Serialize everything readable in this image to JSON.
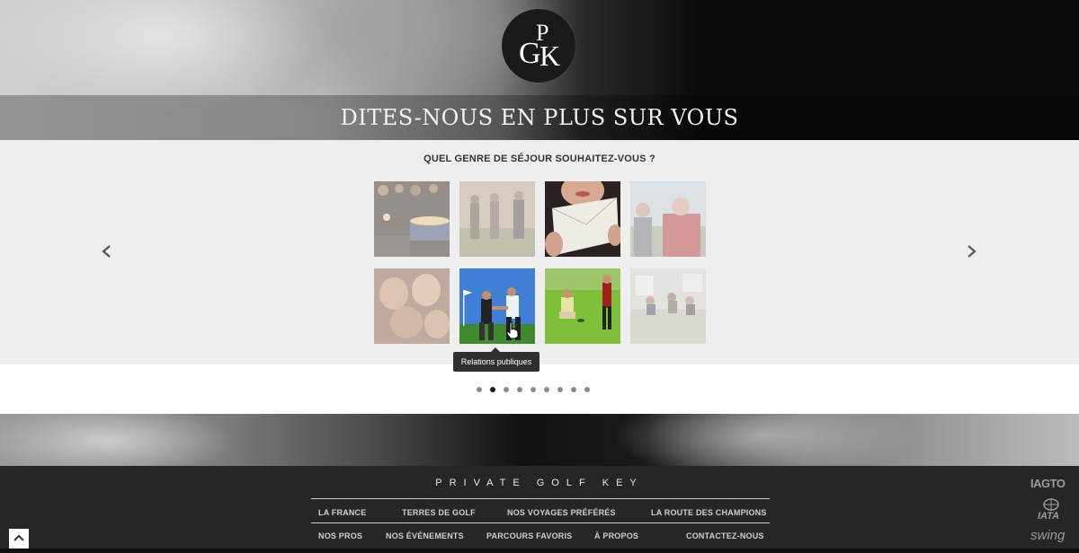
{
  "logo": {
    "glyph_1": "G",
    "glyph_2": "P",
    "glyph_3": "K"
  },
  "hero": {
    "title": "DITES-NOUS EN PLUS SUR VOUS"
  },
  "question": "QUEL GENRE DE SÉJOUR SOUHAITEZ-VOUS ?",
  "carousel": {
    "prev_icon": "chevron-left-icon",
    "next_icon": "chevron-right-icon",
    "options": [
      {
        "key": "soiree-bougies",
        "icon": "candles-photo",
        "faded": true
      },
      {
        "key": "golf-entre-amis",
        "icon": "golfers-photo",
        "faded": true
      },
      {
        "key": "invitation",
        "icon": "invitation-card-photo",
        "faded": false
      },
      {
        "key": "famille-golf",
        "icon": "family-photo",
        "faded": true
      },
      {
        "key": "amis",
        "icon": "friends-photo",
        "faded": true
      },
      {
        "key": "relations-publiques",
        "icon": "handshake-golf-photo",
        "faded": false
      },
      {
        "key": "putting",
        "icon": "putting-green-photo",
        "faded": false
      },
      {
        "key": "seminaire",
        "icon": "meeting-photo",
        "faded": true
      }
    ],
    "tooltip": "Relations publiques",
    "dots": {
      "count": 9,
      "active_index": 1
    }
  },
  "footer": {
    "brand": "PRIVATE GOLF KEY",
    "nav_row_1": [
      "LA FRANCE",
      "TERRES DE GOLF",
      "NOS VOYAGES PRÉFÉRÉS",
      "LA ROUTE DES CHAMPIONS"
    ],
    "nav_row_2": [
      "NOS PROS",
      "NOS ÉVÉNEMENTS",
      "PARCOURS FAVORIS",
      "À PROPOS",
      "CONTACTEZ-NOUS"
    ],
    "partners": [
      "IAGTO",
      "IATA",
      "swing"
    ]
  },
  "colors": {
    "accent": "#1a1a1a",
    "panel": "#eeeeee",
    "footer": "#262626",
    "dot": "#8a8a8a"
  }
}
